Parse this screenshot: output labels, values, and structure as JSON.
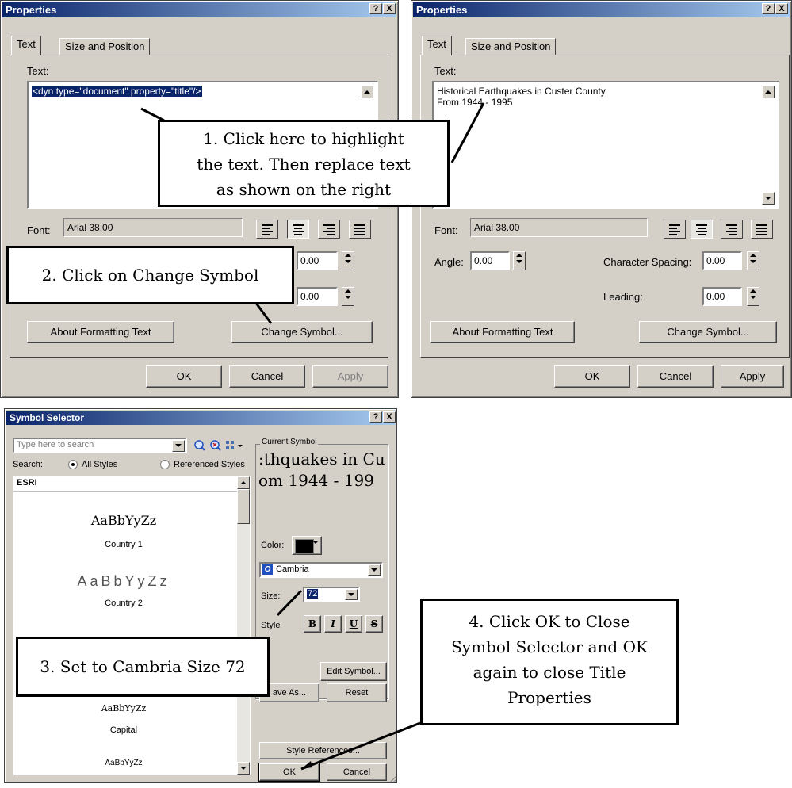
{
  "left_dialog": {
    "title": "Properties",
    "help_btn": "?",
    "close_btn": "X",
    "tabs": [
      "Text",
      "Size and Position"
    ],
    "text_label": "Text:",
    "text_value": "<dyn type=\"document\" property=\"title\"/>",
    "font_label": "Font:",
    "font_value": "Arial 38.00",
    "spin1_value": "0.00",
    "spin2_value": "0.00",
    "about_btn": "About Formatting Text",
    "change_btn": "Change Symbol...",
    "ok_btn": "OK",
    "cancel_btn": "Cancel",
    "apply_btn": "Apply"
  },
  "right_dialog": {
    "title": "Properties",
    "help_btn": "?",
    "close_btn": "X",
    "tabs": [
      "Text",
      "Size and Position"
    ],
    "text_label": "Text:",
    "text_line1": "Historical Earthquakes in Custer County",
    "text_line2": "From 1944 - 1995",
    "font_label": "Font:",
    "font_value": "Arial 38.00",
    "angle_label": "Angle:",
    "angle_value": "0.00",
    "char_spacing_label": "Character Spacing:",
    "char_spacing_value": "0.00",
    "leading_label": "Leading:",
    "leading_value": "0.00",
    "about_btn": "About Formatting Text",
    "change_btn": "Change Symbol...",
    "ok_btn": "OK",
    "cancel_btn": "Cancel",
    "apply_btn": "Apply"
  },
  "symbol_selector": {
    "title": "Symbol Selector",
    "help_btn": "?",
    "close_btn": "X",
    "search_placeholder": "Type here to search",
    "search_label": "Search:",
    "all_styles": "All Styles",
    "referenced_styles": "Referenced Styles",
    "group_header": "ESRI",
    "symbols": [
      {
        "sample": "AaBbYyZz",
        "name": "Country 1"
      },
      {
        "sample": "AaBbYyZz",
        "name": "Country 2"
      },
      {
        "sample": "AaBbYyZz",
        "name": "Capital"
      },
      {
        "sample": "AaBbYyZz",
        "name": ""
      }
    ],
    "current_symbol_label": "Current Symbol",
    "preview_line1": ":thquakes in Cu",
    "preview_line2": "om 1944 - 199",
    "color_label": "Color:",
    "color_value": "#000000",
    "font_value": "Cambria",
    "size_label": "Size:",
    "size_value": "72",
    "style_label": "Style",
    "style_buttons": [
      "B",
      "I",
      "U",
      "S"
    ],
    "edit_symbol_btn": "Edit Symbol...",
    "save_as_btn": "ave As...",
    "reset_btn": "Reset",
    "style_refs_btn": "Style References...",
    "ok_btn": "OK",
    "cancel_btn": "Cancel"
  },
  "callouts": {
    "c1": [
      "1. Click here to highlight",
      "the text. Then replace text",
      "as shown on the right"
    ],
    "c2": "2. Click on Change Symbol",
    "c3": "3. Set to Cambria Size 72",
    "c4": [
      "4. Click OK to Close",
      "Symbol Selector and OK",
      "again to close Title",
      "Properties"
    ]
  }
}
